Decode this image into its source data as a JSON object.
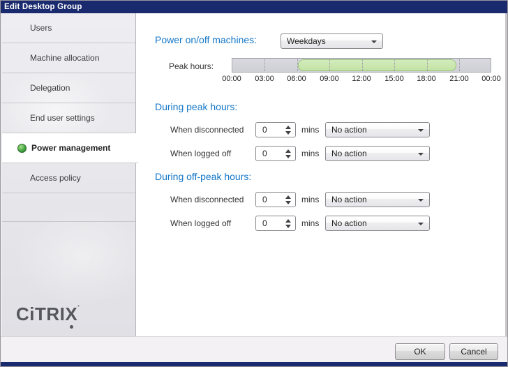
{
  "window": {
    "title": "Edit Desktop Group"
  },
  "sidebar": {
    "items": [
      {
        "label": "Users"
      },
      {
        "label": "Machine allocation"
      },
      {
        "label": "Delegation"
      },
      {
        "label": "End user settings"
      },
      {
        "label": "Power management"
      },
      {
        "label": "Access policy"
      }
    ],
    "selected_index": 4,
    "logo_text": "CiTRIX"
  },
  "main": {
    "power_onoff_label": "Power on/off machines:",
    "power_onoff_value": "Weekdays",
    "peak_hours_label": "Peak hours:",
    "timeline": {
      "tick_labels": [
        "00:00",
        "03:00",
        "06:00",
        "09:00",
        "12:00",
        "15:00",
        "18:00",
        "21:00",
        "00:00"
      ],
      "peak_start": "06:00",
      "peak_end": "21:00"
    },
    "peak_section": {
      "heading": "During peak hours:",
      "rows": [
        {
          "label": "When disconnected",
          "value": "0",
          "unit": "mins",
          "action": "No action"
        },
        {
          "label": "When logged off",
          "value": "0",
          "unit": "mins",
          "action": "No action"
        }
      ]
    },
    "offpeak_section": {
      "heading": "During off-peak hours:",
      "rows": [
        {
          "label": "When disconnected",
          "value": "0",
          "unit": "mins",
          "action": "No action"
        },
        {
          "label": "When logged off",
          "value": "0",
          "unit": "mins",
          "action": "No action"
        }
      ]
    }
  },
  "footer": {
    "ok_label": "OK",
    "cancel_label": "Cancel"
  },
  "colors": {
    "titlebar": "#1a2a6e",
    "heading_blue": "#1577c8",
    "peak_fill": "#c3e2a4",
    "peak_border": "#97c57d",
    "selected_green": "#3fa13f"
  }
}
